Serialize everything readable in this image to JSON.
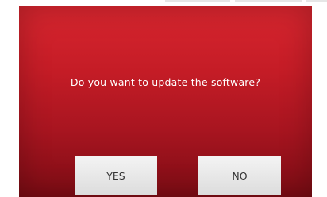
{
  "dialog": {
    "message": "Do you want to update the software?",
    "yes_label": "YES",
    "no_label": "NO"
  },
  "colors": {
    "dialog_top": "#d8262f",
    "dialog_bottom": "#7d0c14",
    "button_bg": "#e8e8e8",
    "button_text": "#333333",
    "message_text": "#ffffff"
  }
}
